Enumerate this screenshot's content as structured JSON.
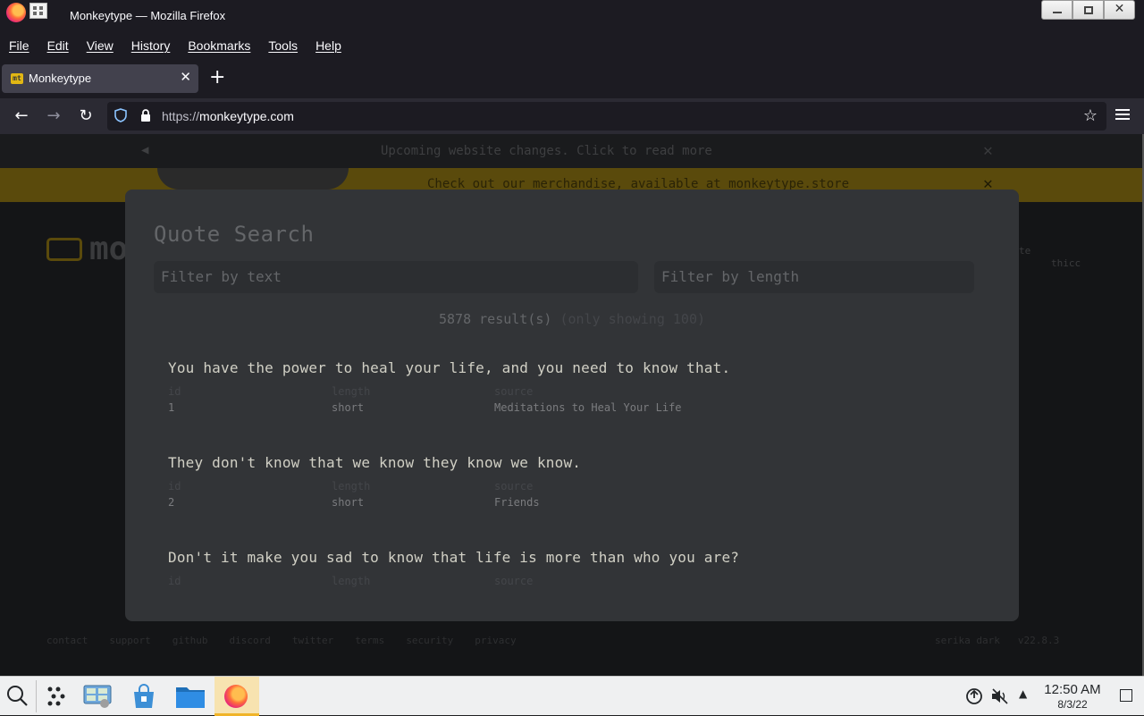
{
  "window": {
    "title": "Monkeytype — Mozilla Firefox",
    "controls": [
      "minimize",
      "maximize",
      "close"
    ]
  },
  "menubar": {
    "items": [
      "File",
      "Edit",
      "View",
      "History",
      "Bookmarks",
      "Tools",
      "Help"
    ]
  },
  "tabs": [
    {
      "label": "Monkeytype",
      "favicon": "mt"
    }
  ],
  "navbar": {
    "url_scheme": "https://",
    "url_host": "monkeytype.com"
  },
  "page": {
    "banner_notice": "Upcoming website changes. Click to read more",
    "banner_merch": "Check out our merchandise, available at monkeytype.store",
    "logo_text": "mo",
    "right_text_1": "te",
    "right_text_2": "thicc",
    "footer_left": [
      "contact",
      "support",
      "github",
      "discord",
      "twitter",
      "terms",
      "security",
      "privacy"
    ],
    "footer_right": [
      "serika dark",
      "v22.8.3"
    ]
  },
  "modal": {
    "title": "Quote Search",
    "filter_text_placeholder": "Filter by text",
    "filter_length_placeholder": "Filter by length",
    "result_count": "5878 result(s)",
    "result_note": "(only showing 100)",
    "column_headers": {
      "id": "id",
      "length": "length",
      "source": "source"
    },
    "quotes": [
      {
        "text": "You have the power to heal your life, and you need to know that.",
        "id": "1",
        "length": "short",
        "source": "Meditations to Heal Your Life"
      },
      {
        "text": "They don't know that we know they know we know.",
        "id": "2",
        "length": "short",
        "source": "Friends"
      },
      {
        "text": "Don't it make you sad to know that life is more than who you are?",
        "id": "",
        "length": "",
        "source": ""
      }
    ]
  },
  "taskbar": {
    "time": "12:50 AM",
    "date": "8/3/22"
  },
  "colors": {
    "background": "#323437",
    "accent": "#e2b714",
    "text": "#d1d0c5",
    "sub": "#646669"
  }
}
